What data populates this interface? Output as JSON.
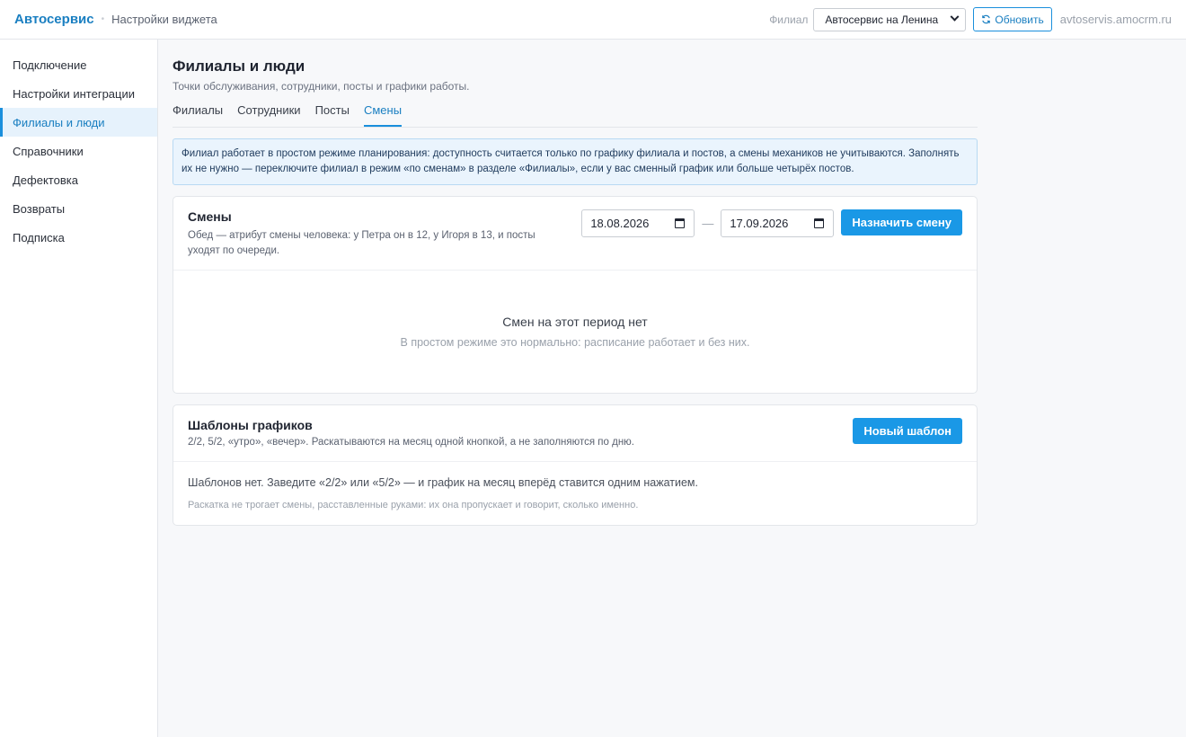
{
  "header": {
    "brand": "Автосервис",
    "subtitle": "Настройки виджета",
    "filial_label": "Филиал",
    "filial_selected": "Автосервис на Ленина",
    "refresh_label": "Обновить",
    "domain": "avtoservis.amocrm.ru"
  },
  "sidebar": {
    "items": [
      {
        "label": "Подключение"
      },
      {
        "label": "Настройки интеграции"
      },
      {
        "label": "Филиалы и люди"
      },
      {
        "label": "Справочники"
      },
      {
        "label": "Дефектовка"
      },
      {
        "label": "Возвраты"
      },
      {
        "label": "Подписка"
      }
    ],
    "active": "Филиалы и люди"
  },
  "page": {
    "title": "Филиалы и люди",
    "description": "Точки обслуживания, сотрудники, посты и графики работы.",
    "tabs": [
      {
        "label": "Филиалы"
      },
      {
        "label": "Сотрудники"
      },
      {
        "label": "Посты"
      },
      {
        "label": "Смены"
      }
    ],
    "active_tab": "Смены",
    "info": "Филиал работает в простом режиме планирования: доступность считается только по графику филиала и постов, а смены механиков не учитываются. Заполнять их не нужно — переключите филиал в режим «по сменам» в разделе «Филиалы», если у вас сменный график или больше четырёх постов."
  },
  "shifts": {
    "title": "Смены",
    "subtitle": "Обед — атрибут смены человека: у Петра он в 12, у Игоря в 13, и посты уходят по очереди.",
    "date_from": "18.08.2026",
    "date_sep": "—",
    "date_to": "17.09.2026",
    "assign_label": "Назначить смену",
    "empty_title": "Смен на этот период нет",
    "empty_sub": "В простом режиме это нормально: расписание работает и без них."
  },
  "templates": {
    "title": "Шаблоны графиков",
    "subtitle": "2/2, 5/2, «утро», «вечер». Раскатываются на месяц одной кнопкой, а не заполняются по дню.",
    "new_label": "Новый шаблон",
    "empty_text": "Шаблонов нет. Заведите «2/2» или «5/2» — и график на месяц вперёд ставится одним нажатием.",
    "hint": "Раскатка не трогает смены, расставленные руками: их она пропускает и говорит, сколько именно."
  }
}
